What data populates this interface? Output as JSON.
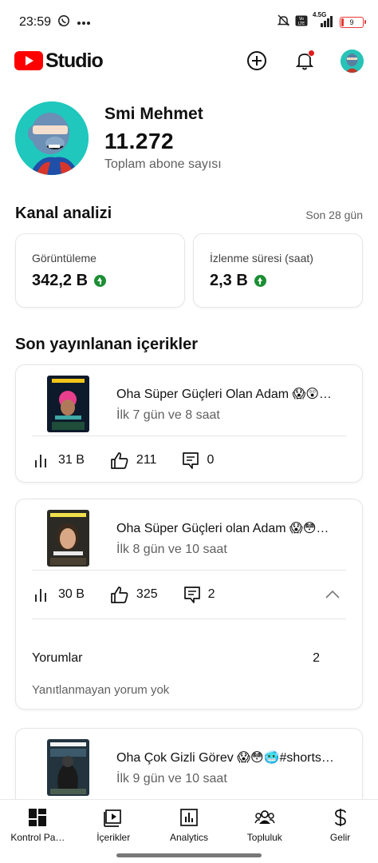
{
  "status_bar": {
    "time": "23:59",
    "battery": "9",
    "network": "4.5G"
  },
  "app": {
    "brand": "Studio"
  },
  "channel": {
    "name": "Smi Mehmet",
    "subscriber_count": "11.272",
    "subscriber_label": "Toplam abone sayısı"
  },
  "analytics": {
    "title": "Kanal analizi",
    "period": "Son 28 gün",
    "views": {
      "label": "Görüntüleme",
      "value": "342,2 B",
      "trend": "up"
    },
    "watch_time": {
      "label": "İzlenme süresi (saat)",
      "value": "2,3 B",
      "trend": "up"
    }
  },
  "recent": {
    "title": "Son yayınlanan içerikler",
    "videos": [
      {
        "title": "Oha Süper Güçleri Olan Adam 😱😲…",
        "age": "İlk 7 gün ve 8 saat",
        "views": "31 B",
        "likes": "211",
        "comments": "0"
      },
      {
        "title": "Oha Süper Güçleri olan Adam 😱😳…",
        "age": "İlk 8 gün ve 10 saat",
        "views": "30 B",
        "likes": "325",
        "comments": "2",
        "expanded": {
          "comments_label": "Yorumlar",
          "comments_count": "2",
          "unanswered_text": "Yanıtlanmayan yorum yok"
        }
      },
      {
        "title": "Oha Çok Gizli Görev 😱😳🥶#shorts…",
        "age": "İlk 9 gün ve 10 saat"
      }
    ]
  },
  "nav": {
    "items": [
      {
        "label": "Kontrol Pa…",
        "icon": "dashboard-icon"
      },
      {
        "label": "İçerikler",
        "icon": "content-icon"
      },
      {
        "label": "Analytics",
        "icon": "analytics-icon"
      },
      {
        "label": "Topluluk",
        "icon": "community-icon"
      },
      {
        "label": "Gelir",
        "icon": "earn-icon"
      }
    ]
  },
  "colors": {
    "brand_red": "#ff0000",
    "trend_green": "#1b8e33",
    "notification_red": "#e21b1b"
  }
}
